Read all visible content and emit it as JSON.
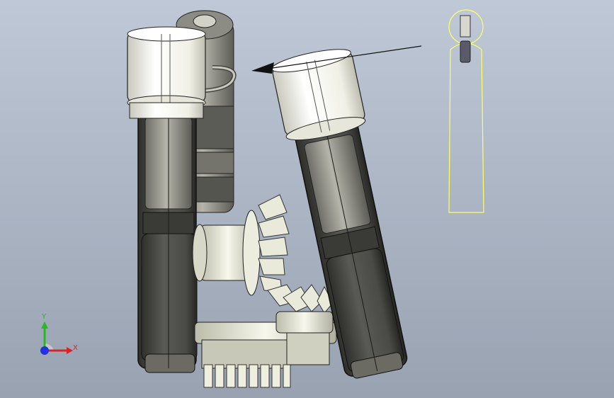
{
  "viewport": {
    "background": "#adb7c6",
    "model_shade": "#f2f2e8",
    "model_dark": "#4f4f4b",
    "preview_outline": "#ffff66"
  },
  "triad": {
    "y_label": "Y",
    "x_label": "X",
    "y_color": "#22bb22",
    "x_color": "#dd2222",
    "z_color": "#2233dd"
  },
  "icons": {
    "triad": "coordinate-triad-icon",
    "arrow": "direction-arrow-icon"
  }
}
